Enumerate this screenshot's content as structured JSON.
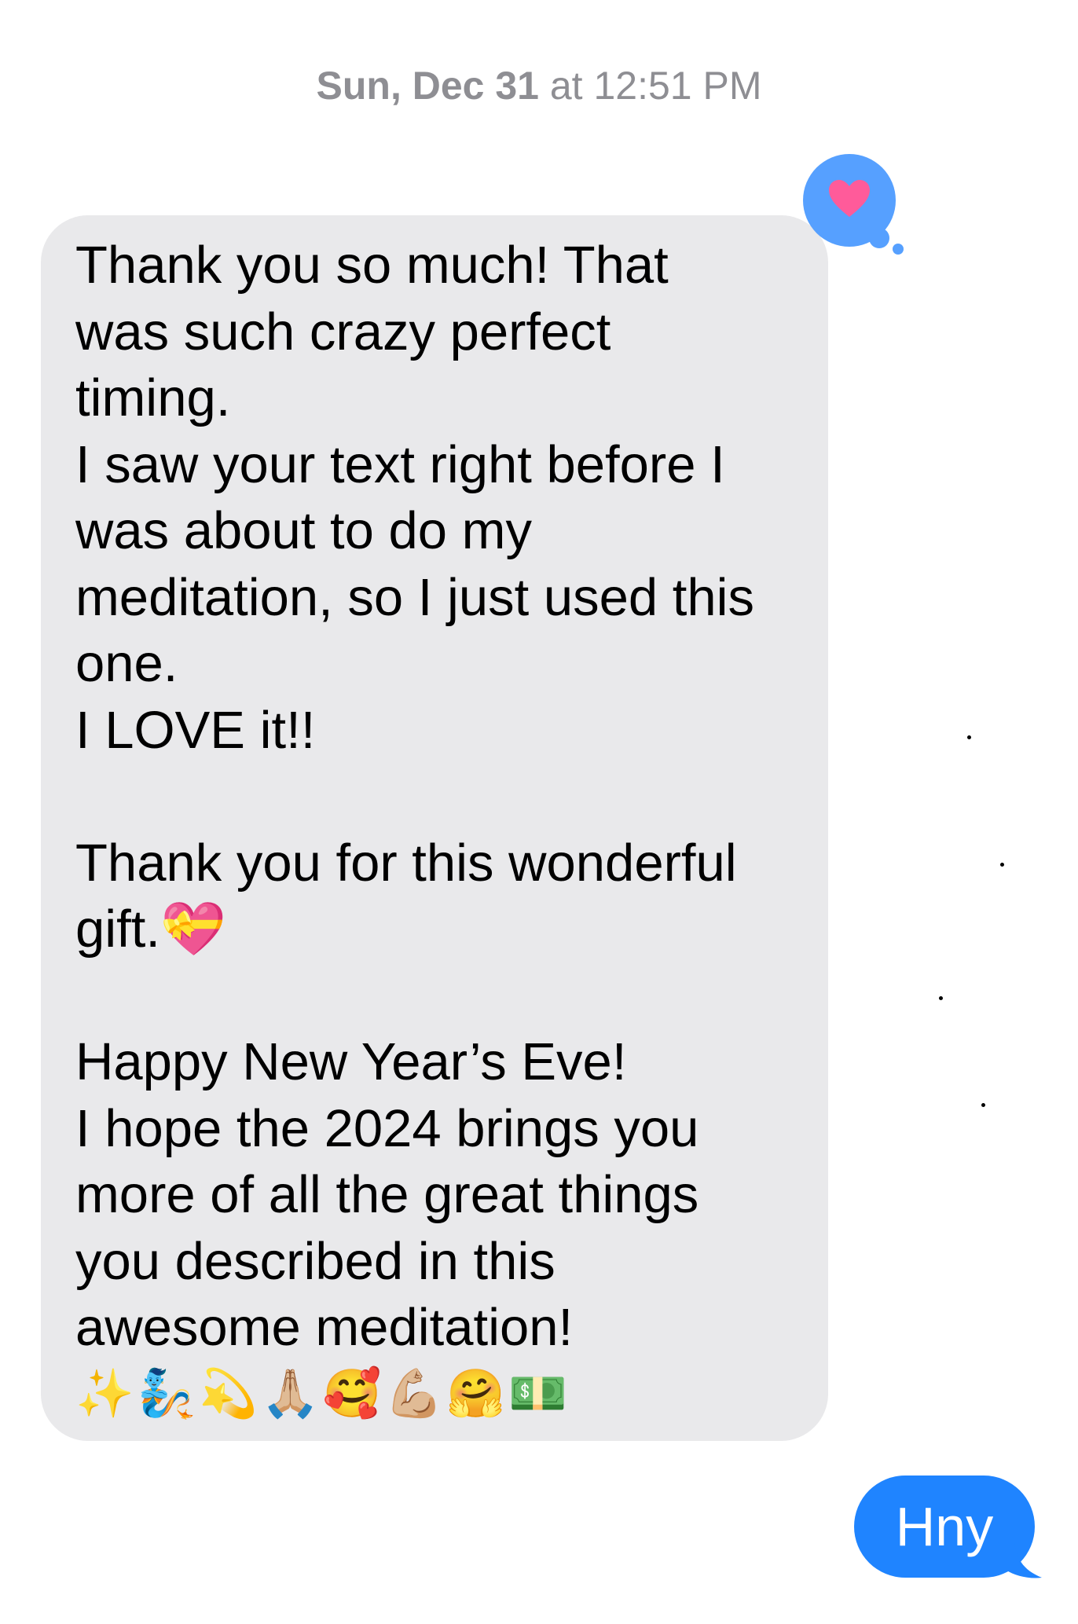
{
  "conversation": {
    "timestamp": {
      "day": "Sun, Dec 31",
      "time": " at 12:51 PM"
    },
    "incoming_message": {
      "text": "Thank you so much! That\nwas such crazy perfect\ntiming.\nI saw your text right before I\nwas about to do my\nmeditation, so I just used this\none.\nI LOVE it!!\n\nThank you for this wonderful\ngift.💝\n\nHappy New Year’s Eve!\nI hope the 2024 brings you\nmore of all the great things\nyou described in this\nawesome meditation!",
      "emojis": "✨🧞💫🙏🏼🥰💪🏼🤗💵",
      "tapback": "heart-icon"
    },
    "outgoing_message": {
      "text": "Hny"
    }
  },
  "colors": {
    "incoming_bubble": "#e9e9eb",
    "outgoing_bubble": "#1f84ff",
    "tapback_bubble": "#56a0ff",
    "heart": "#ff5b9a",
    "timestamp": "#8e8e93"
  }
}
